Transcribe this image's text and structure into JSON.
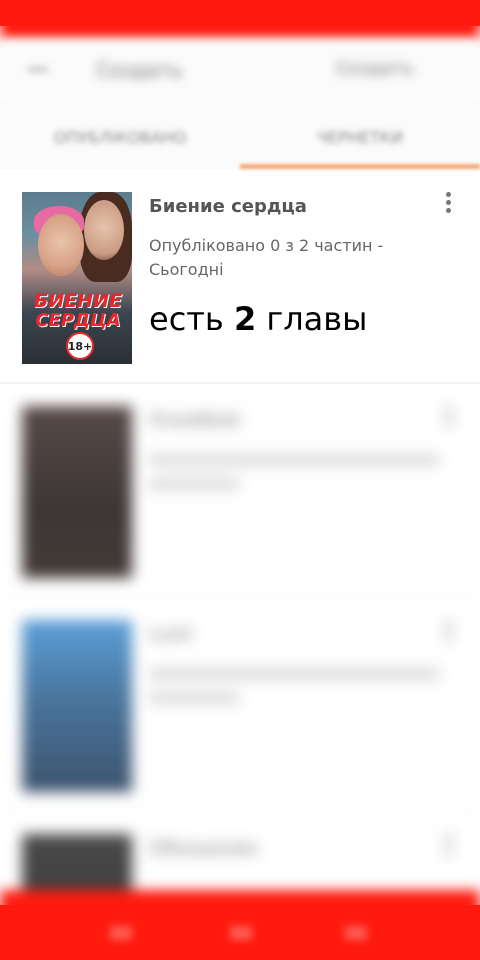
{
  "header": {
    "title": "Создать",
    "action": "Создать"
  },
  "tabs": [
    {
      "label": "ОПУБЛІКОВАНО"
    },
    {
      "label": "ЧЕРНЕТКИ"
    }
  ],
  "stories": [
    {
      "title": "Биение сердца",
      "meta": "Опубліковано 0 з 2 частин - Сьогодні",
      "note_prefix": "есть ",
      "note_number": "2",
      "note_suffix": " главы",
      "cover_title_line1": "БИЕНИЕ",
      "cover_title_line2": "СЕРДЦА",
      "cover_badge": "18+"
    },
    {
      "title": "Плейбой"
    },
    {
      "title": "Lost"
    },
    {
      "title": "Обещание"
    }
  ],
  "colors": {
    "accent": "#ff1a10",
    "tab_indicator": "#f7a878"
  },
  "icons": {
    "back": "arrow-back-icon",
    "more": "more-vertical-icon"
  }
}
